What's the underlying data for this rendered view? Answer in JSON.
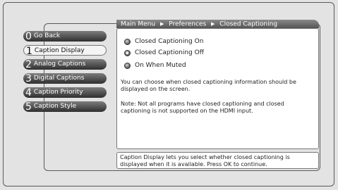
{
  "breadcrumb": {
    "items": [
      "Main Menu",
      "Preferences",
      "Closed Captioning"
    ]
  },
  "menu": {
    "items": [
      {
        "num": "0",
        "label": "Go Back"
      },
      {
        "num": "1",
        "label": "Caption Display",
        "selected": true
      },
      {
        "num": "2",
        "label": "Analog Captions"
      },
      {
        "num": "3",
        "label": "Digital Captions"
      },
      {
        "num": "4",
        "label": "Caption Priority"
      },
      {
        "num": "5",
        "label": "Caption Style"
      }
    ]
  },
  "options": {
    "items": [
      {
        "label": "Closed Captioning On",
        "checked": false
      },
      {
        "label": "Closed Captioning Off",
        "checked": true
      },
      {
        "label": "On When Muted",
        "checked": false
      }
    ]
  },
  "content": {
    "description": "You can choose when closed captioning information should be displayed on the screen.",
    "note": "Note: Not all programs have closed captioning and closed captioning is not supported on the HDMI input."
  },
  "help": {
    "text": "Caption Display lets you select whether closed captioning is displayed when it is available. Press OK to continue."
  }
}
